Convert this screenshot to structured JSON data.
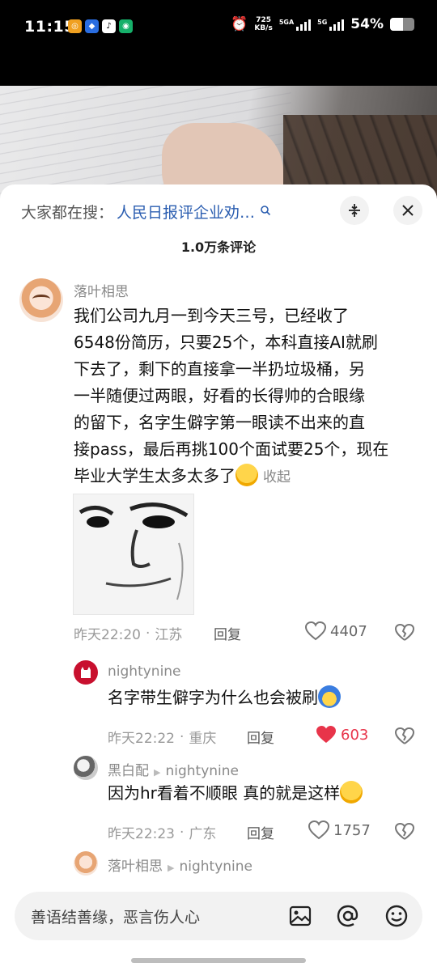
{
  "status_bar": {
    "time": "11:15",
    "net_speed_value": "725",
    "net_speed_unit": "KB/s",
    "sim1_label": "5GA",
    "sim2_label": "5G",
    "battery_percent": "54%",
    "battery_level": 0.54
  },
  "header": {
    "search_prefix": "大家都在搜：",
    "search_term": "人民日报评企业劝…",
    "comment_count": "1.0万条评论"
  },
  "comments": [
    {
      "username": "落叶相思",
      "text_lines": [
        "我们公司九月一到今天三号，已经收了",
        "6548份简历，只要25个，本科直接AI就刷",
        "下去了，剩下的直接拿一半扔垃圾桶，另",
        "一半随便过两眼，好看的长得帅的合眼缘",
        "的留下，名字生僻字第一眼读不出来的直",
        "接pass，最后再挑100个面试要25个，现在",
        "毕业大学生太多太多了"
      ],
      "collapse_label": "收起",
      "time": "昨天22:20",
      "location": "江苏",
      "reply_label": "回复",
      "likes": "4407",
      "liked": false
    },
    {
      "username": "nightynine",
      "text": "名字带生僻字为什么也会被刷",
      "time": "昨天22:22",
      "location": "重庆",
      "reply_label": "回复",
      "likes": "603",
      "liked": true
    },
    {
      "username": "黑白配",
      "reply_to": "nightynine",
      "text": "因为hr看着不顺眼 真的就是这样",
      "time": "昨天22:23",
      "location": "广东",
      "reply_label": "回复",
      "likes": "1757",
      "liked": false
    },
    {
      "username": "落叶相思",
      "reply_to": "nightynine"
    }
  ],
  "bottom_bar": {
    "input_placeholder": "善语结善缘，恶言伤人心"
  },
  "colors": {
    "link_blue": "#2a5db0",
    "like_red": "#e8344a"
  }
}
